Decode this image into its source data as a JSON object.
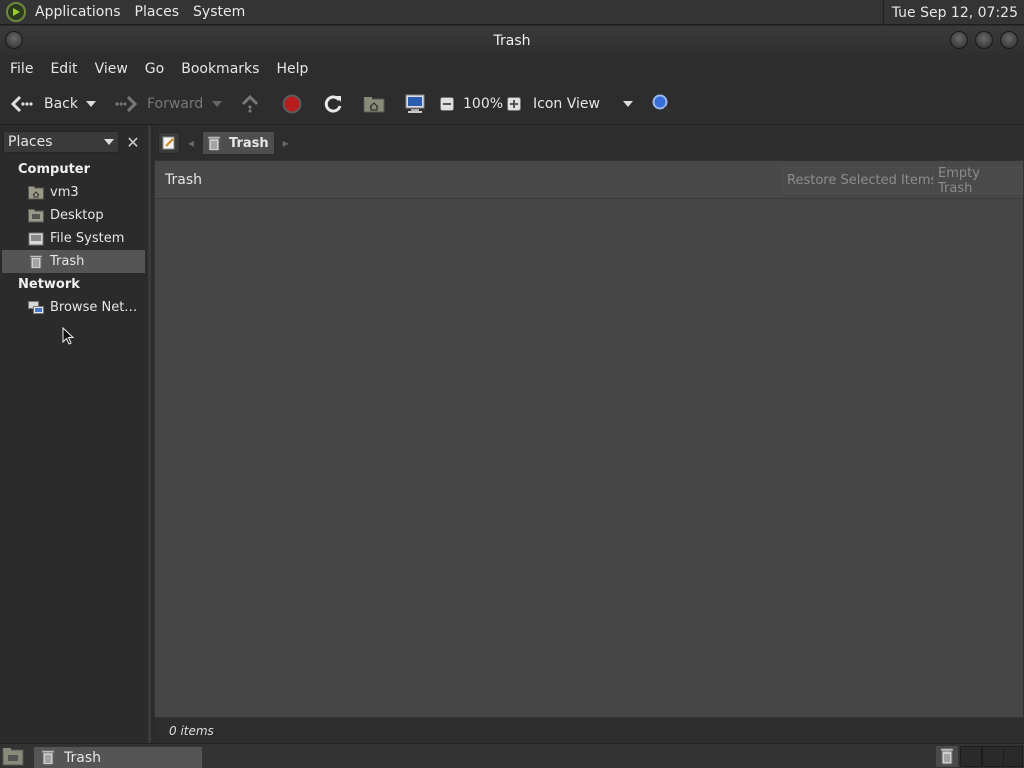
{
  "top_panel": {
    "menu": [
      "Applications",
      "Places",
      "System"
    ],
    "clock": "Tue Sep 12, 07:25"
  },
  "window": {
    "title": "Trash"
  },
  "menubar": [
    "File",
    "Edit",
    "View",
    "Go",
    "Bookmarks",
    "Help"
  ],
  "toolbar": {
    "back": "Back",
    "forward": "Forward",
    "zoom": "100%",
    "view_mode": "Icon View"
  },
  "sidebar": {
    "selector": "Places",
    "sections": [
      {
        "title": "Computer",
        "items": [
          "vm3",
          "Desktop",
          "File System",
          "Trash"
        ]
      },
      {
        "title": "Network",
        "items": [
          "Browse Net…"
        ]
      }
    ]
  },
  "location": {
    "crumb": "Trash"
  },
  "content": {
    "header": "Trash",
    "restore": "Restore Selected Items",
    "empty": "Empty Trash"
  },
  "status": "0 items",
  "taskbar": {
    "task": "Trash"
  }
}
